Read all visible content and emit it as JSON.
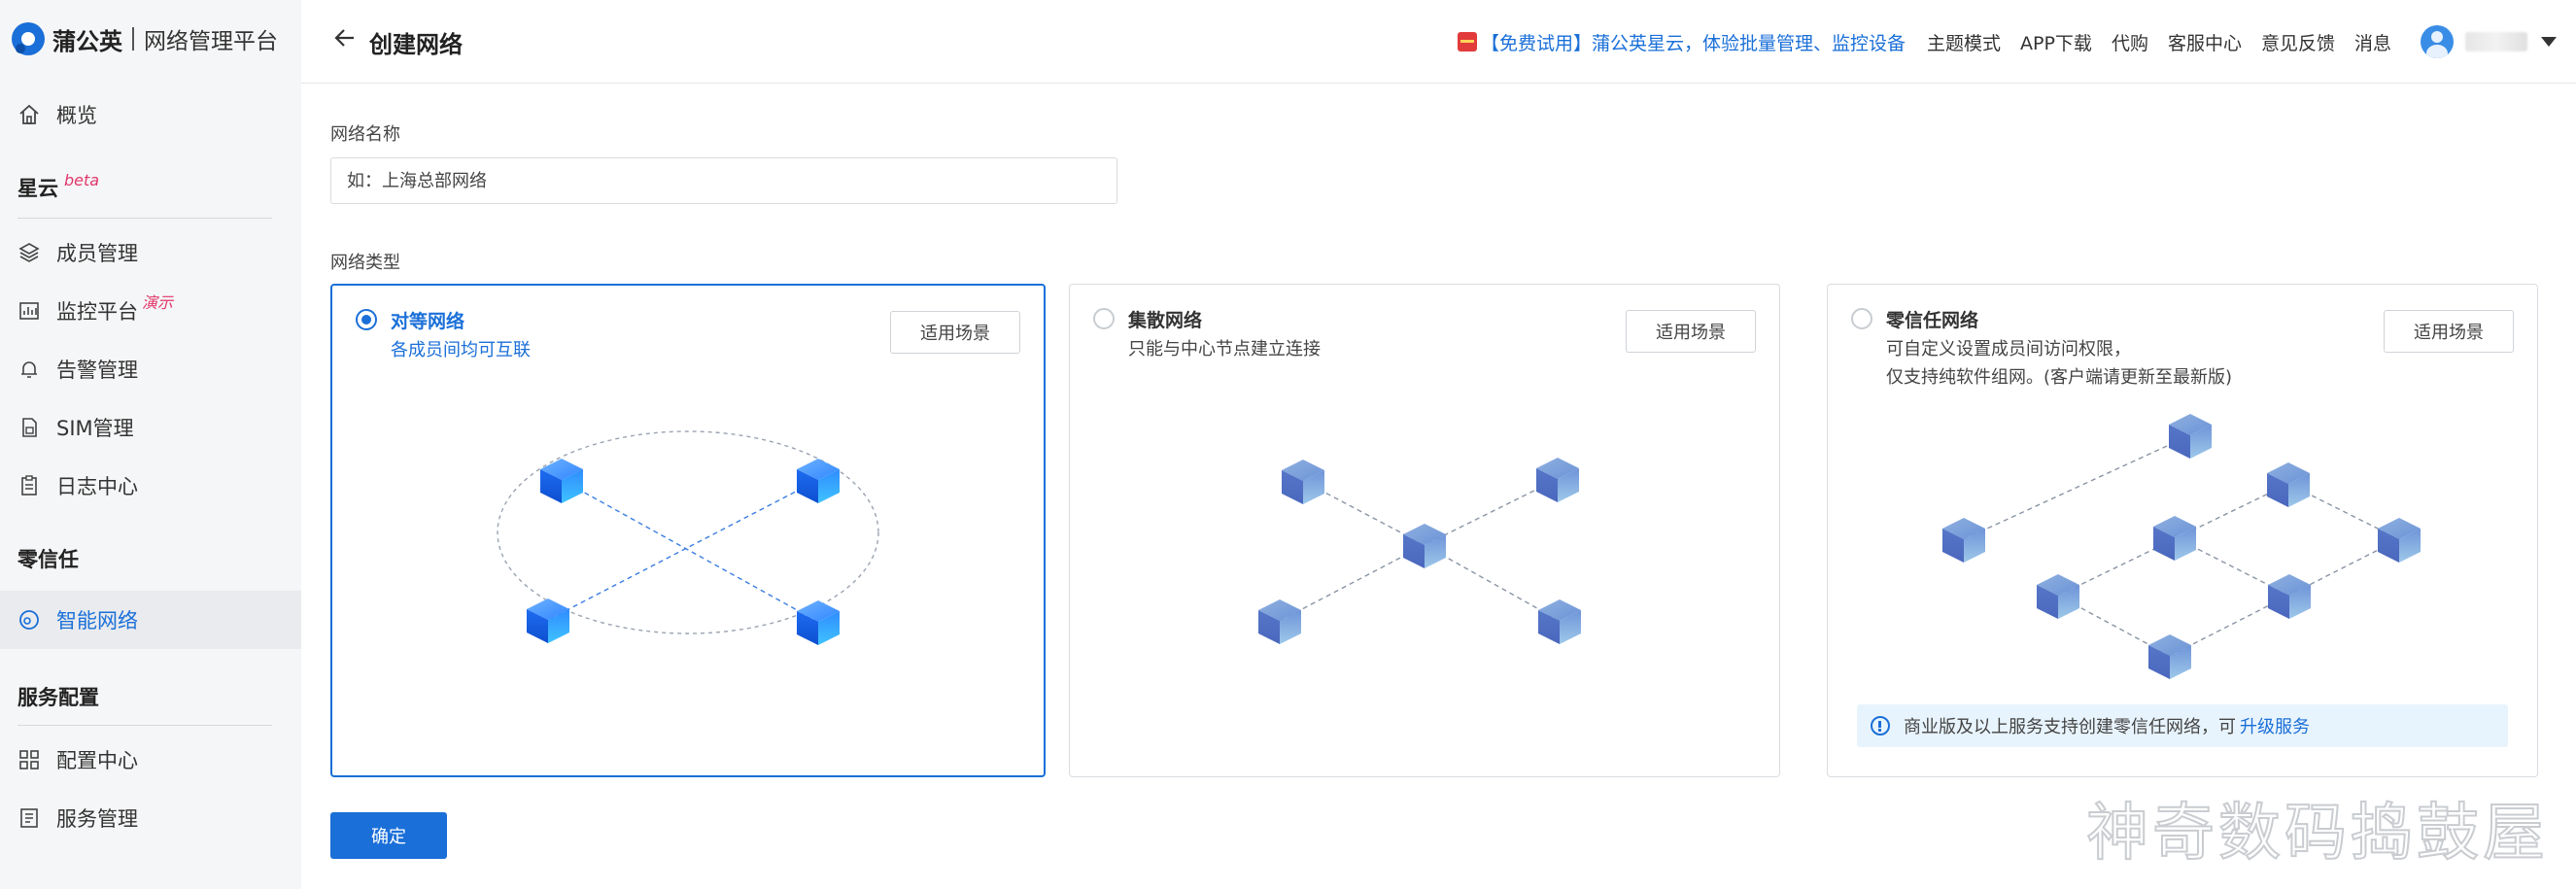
{
  "brand": {
    "name": "蒲公英",
    "subtitle": "网络管理平台"
  },
  "sidebar": {
    "overview": "概览",
    "groups": [
      {
        "title": "星云",
        "tag": "beta"
      },
      {
        "title": "零信任"
      },
      {
        "title": "服务配置"
      }
    ],
    "items": [
      {
        "label": "成员管理"
      },
      {
        "label": "监控平台",
        "tag": "演示"
      },
      {
        "label": "告警管理"
      },
      {
        "label": "SIM管理"
      },
      {
        "label": "日志中心"
      },
      {
        "label": "智能网络",
        "active": true
      },
      {
        "label": "配置中心"
      },
      {
        "label": "服务管理"
      }
    ]
  },
  "header": {
    "title": "创建网络",
    "promo": "【免费试用】蒲公英星云，体验批量管理、监控设备",
    "links": [
      "主题模式",
      "APP下载",
      "代购",
      "客服中心",
      "意见反馈",
      "消息"
    ]
  },
  "form": {
    "name_label": "网络名称",
    "name_placeholder": "如：上海总部网络",
    "type_label": "网络类型",
    "types": [
      {
        "title": "对等网络",
        "desc": "各成员间均可互联",
        "selected": true,
        "button": "适用场景"
      },
      {
        "title": "集散网络",
        "desc": "只能与中心节点建立连接",
        "selected": false,
        "button": "适用场景"
      },
      {
        "title": "零信任网络",
        "desc_line1": "可自定义设置成员间访问权限，",
        "desc_line2": "仅支持纯软件组网。(客户端请更新至最新版)",
        "selected": false,
        "button": "适用场景"
      }
    ],
    "notice": "商业版及以上服务支持创建零信任网络，可",
    "notice_link": "升级服务",
    "confirm": "确定"
  },
  "watermark": "神奇数码捣鼓屋",
  "colors": {
    "accent": "#1a6fd8",
    "sidebar_bg": "#f5f6f7",
    "active_bg": "#e9ebee",
    "tag": "#e2366a",
    "notice_bg": "#e8f4fd"
  }
}
